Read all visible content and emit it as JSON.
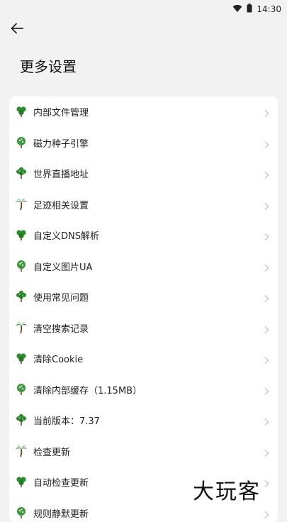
{
  "status_bar": {
    "time": "14:30"
  },
  "header": {
    "title": "更多设置"
  },
  "settings": {
    "items": [
      {
        "label": "内部文件管理",
        "icon": "clover-tree-icon"
      },
      {
        "label": "磁力种子引擎",
        "icon": "round-tree-icon"
      },
      {
        "label": "世界直播地址",
        "icon": "bushy-tree-icon"
      },
      {
        "label": "足迹相关设置",
        "icon": "palm-tree-icon"
      },
      {
        "label": "自定义DNS解析",
        "icon": "clover-tree-icon"
      },
      {
        "label": "自定义图片UA",
        "icon": "round-tree-icon"
      },
      {
        "label": "使用常见问题",
        "icon": "bushy-tree-icon"
      },
      {
        "label": "清空搜索记录",
        "icon": "palm-tree-icon"
      },
      {
        "label": "清除Cookie",
        "icon": "clover-tree-icon"
      },
      {
        "label": "清除内部缓存（1.15MB）",
        "icon": "round-tree-icon"
      },
      {
        "label": "当前版本：7.37",
        "icon": "bushy-tree-icon"
      },
      {
        "label": "检查更新",
        "icon": "palm-tree-icon"
      },
      {
        "label": "自动检查更新",
        "icon": "clover-tree-icon"
      },
      {
        "label": "规则静默更新",
        "icon": "round-tree-icon"
      }
    ]
  },
  "watermark": {
    "text": "大玩客"
  },
  "colors": {
    "background": "#f2f2f2",
    "card": "#ffffff",
    "icon_green": "#2e8b2e",
    "trunk": "#6b4a2b",
    "chevron": "#c8c8c8"
  }
}
